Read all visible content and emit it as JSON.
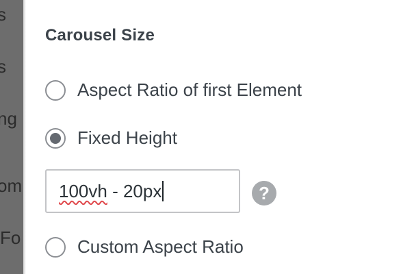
{
  "backdrop": {
    "items": [
      {
        "text": "s"
      },
      {
        "text": "s"
      },
      {
        "text": "ng"
      },
      {
        "text": "om"
      },
      {
        "text": "Fo"
      }
    ]
  },
  "section": {
    "title": "Carousel Size"
  },
  "options": [
    {
      "label": "Aspect Ratio of first Element",
      "checked": false
    },
    {
      "label": "Fixed Height",
      "checked": true
    },
    {
      "label": "Custom Aspect Ratio",
      "checked": false
    }
  ],
  "height_input": {
    "value_word": "100vh",
    "value_rest": " - 20px"
  },
  "help": {
    "glyph": "?"
  },
  "colors": {
    "text": "#3c434a",
    "radio_border": "#8c8f94",
    "radio_dot": "#646970",
    "input_border": "#c3c4c7",
    "help_bg": "#a7aaad",
    "spellcheck": "#e0484c",
    "backdrop": "#6d6d6d"
  }
}
